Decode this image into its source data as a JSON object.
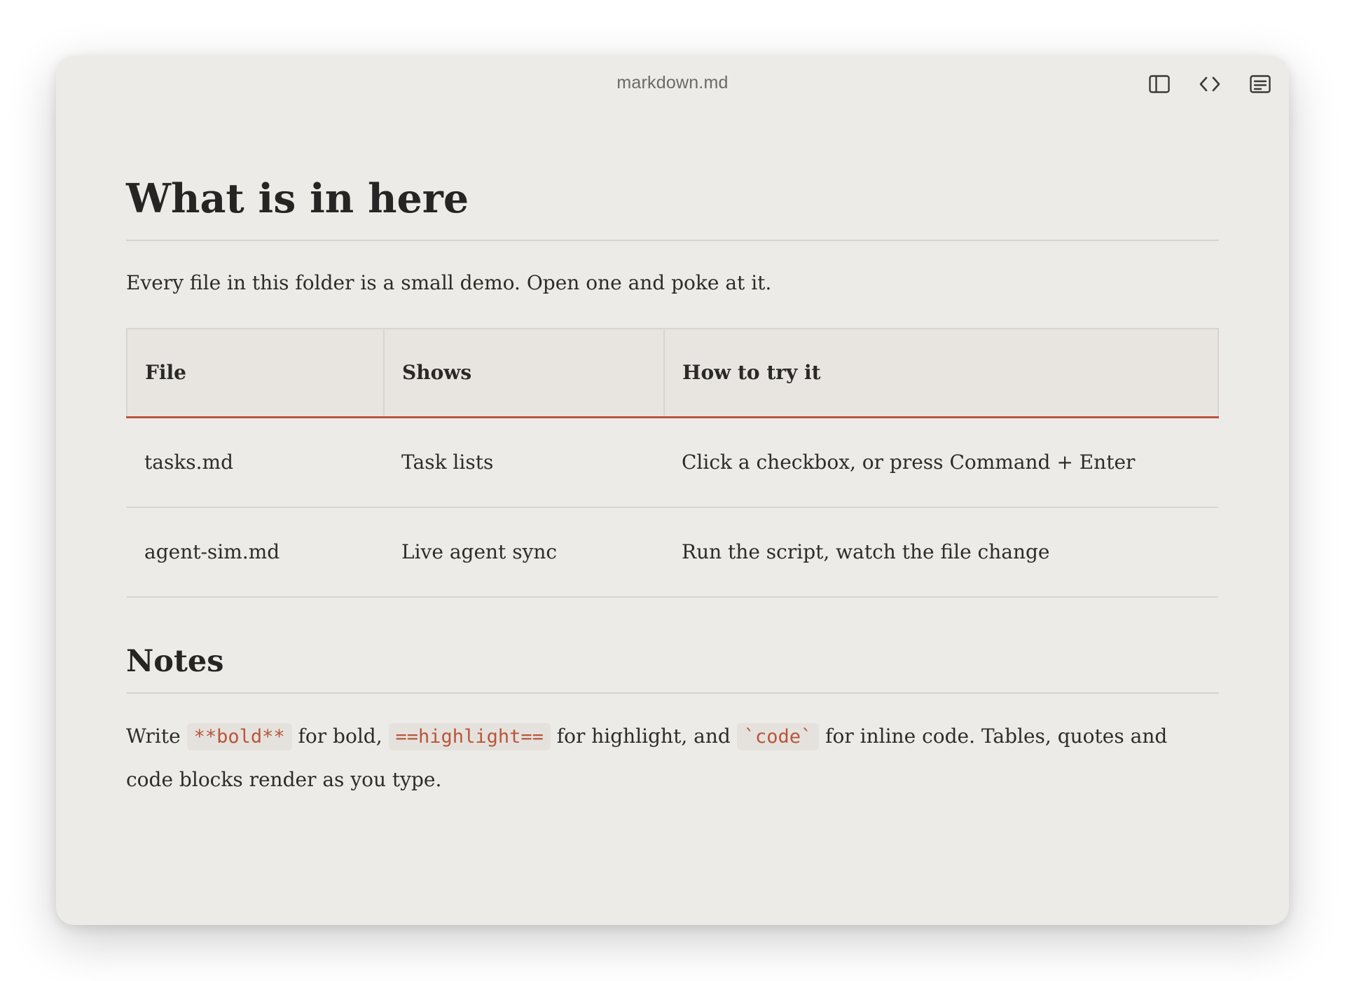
{
  "window": {
    "title": "markdown.md"
  },
  "toolbar": {
    "icons": [
      "sidebar-toggle-icon",
      "code-brackets-icon",
      "document-outline-icon"
    ]
  },
  "document": {
    "heading": "What is in here",
    "intro": "Every file in this folder is a small demo. Open one and poke at it.",
    "table": {
      "headers": [
        "File",
        "Shows",
        "How to try it"
      ],
      "rows": [
        [
          "tasks.md",
          "Task lists",
          "Click a checkbox, or press Command + Enter"
        ],
        [
          "agent-sim.md",
          "Live agent sync",
          "Run the script, watch the file change"
        ]
      ]
    },
    "notes": {
      "heading": "Notes",
      "text_write": "Write",
      "code_bold": "**bold**",
      "text_for_bold": "for bold,",
      "code_highlight": "==highlight==",
      "text_for_highlight": "for highlight, and",
      "code_code": "`code`",
      "text_rest": "for inline code. Tables, quotes and code blocks render as you type."
    }
  },
  "colors": {
    "background": "#edebe7",
    "accent": "#b9553b",
    "text": "#2b2a28",
    "divider": "#d6d3ce",
    "table_header": "#e8e5e1"
  }
}
